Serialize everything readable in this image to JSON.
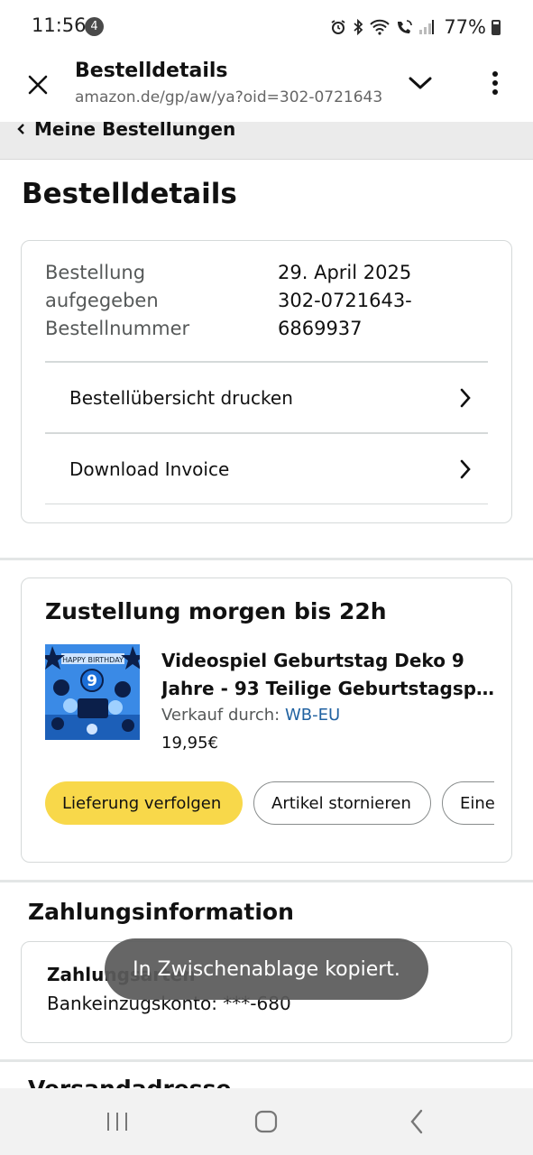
{
  "status_bar": {
    "time": "11:56",
    "notification_count": "4",
    "battery": "77%",
    "icons": [
      "alarm-icon",
      "bluetooth-icon",
      "wifi-icon",
      "wifi-call-icon",
      "signal-icon",
      "battery-icon"
    ]
  },
  "browser": {
    "title": "Bestelldetails",
    "url": "amazon.de/gp/aw/ya?oid=302-0721643-6869937"
  },
  "breadcrumb": {
    "label": "Meine Bestellungen"
  },
  "page": {
    "title": "Bestelldetails"
  },
  "order_summary": {
    "labels": [
      "Bestellung",
      "aufgegeben",
      "Bestellnummer"
    ],
    "values": [
      "29. April 2025",
      "302-0721643-",
      "6869937"
    ],
    "actions": {
      "print": "Bestellübersicht drucken",
      "invoice": "Download Invoice"
    }
  },
  "shipment": {
    "heading": "Zustellung morgen bis 22h",
    "product": {
      "title_line1": "Videospiel Geburtstag Deko 9",
      "title_line2": "Jahre - 93 Teilige Geburtstagsp...",
      "seller_prefix": "Verkauf durch: ",
      "seller_name": "WB-EU",
      "price": "19,95€"
    },
    "buttons": {
      "track": "Lieferung verfolgen",
      "cancel": "Artikel stornieren",
      "third": "Eine"
    }
  },
  "payment": {
    "heading": "Zahlungsinformation",
    "method_label": "Zahlungsarten",
    "method_value": "Bankeinzugskonto: ***-680"
  },
  "next_section": {
    "heading": "Versandadresse"
  },
  "toast": {
    "message": "In Zwischenablage kopiert."
  },
  "colors": {
    "primary_button": "#f8d84a",
    "link": "#2162a1",
    "divider": "#d5d9d9"
  }
}
